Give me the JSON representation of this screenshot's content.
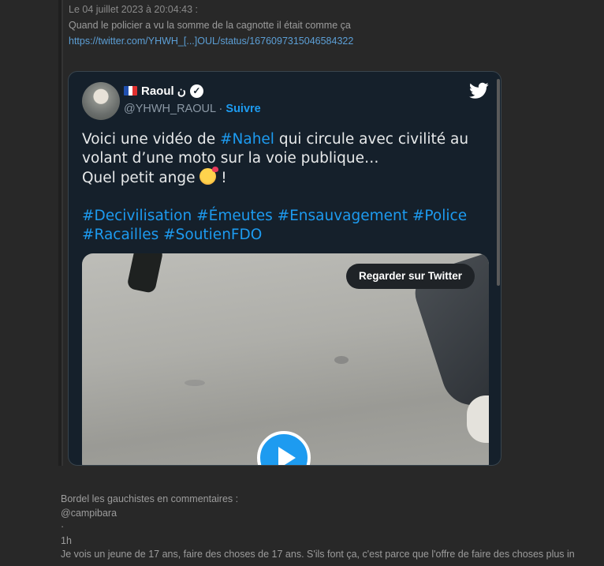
{
  "quote": {
    "date": "Le 04 juillet 2023 à 20:04:43 :",
    "text": "Quand le policier a vu la somme de la cagnotte il était comme ça",
    "link": "https://twitter.com/YHWH_[...]OUL/status/1676097315046584322"
  },
  "tweet": {
    "author_name": "Raoul ن",
    "handle": "@YHWH_RAOUL",
    "separator": " · ",
    "follow_label": "Suivre",
    "text": {
      "line1_pre": "Voici une vidéo de ",
      "line1_tag": "#Nahel",
      "line1_post": " qui circule avec civilité au",
      "line2": "volant d’une moto sur la voie publique…",
      "line3_pre": "Quel petit ange ",
      "line3_post": " !",
      "tags_row1": [
        "#Decivilisation",
        "#Émeutes",
        "#Ensauvagement",
        "#Police"
      ],
      "tags_row2": [
        "#Racailles",
        "#SoutienFDO"
      ]
    },
    "watch_label": "Regarder sur Twitter"
  },
  "post": {
    "line1": "Bordel les gauchistes en commentaires :",
    "line2": "@campibara",
    "line3": "·",
    "line4": "1h",
    "line5": "Je vois un jeune de 17 ans, faire des choses de 17 ans. S'ils font ça, c'est parce que l'offre de faire des choses plus in"
  },
  "colors": {
    "page_bg": "#282828",
    "tweet_bg": "#15202b",
    "twitter_blue": "#1d9bf0",
    "link": "#5c9fd6"
  },
  "icons": {
    "brand": "twitter-bird-icon",
    "verified": "verified-badge-icon",
    "flag": "france-flag-icon",
    "play": "play-icon"
  }
}
